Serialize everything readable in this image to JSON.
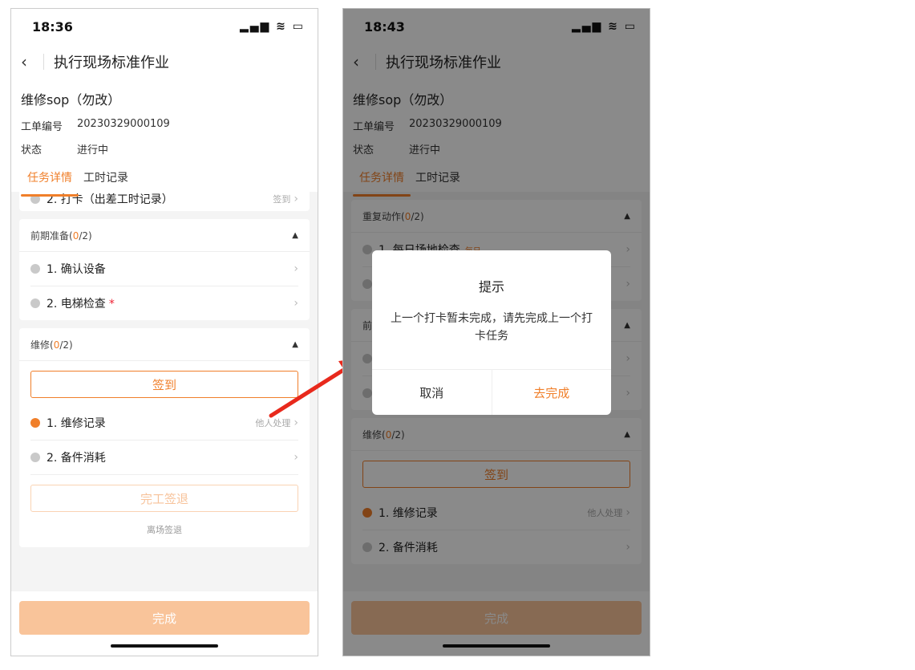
{
  "phone1": {
    "time": "18:36",
    "nav_title": "执行现场标准作业",
    "order_title": "维修sop（勿改）",
    "order_no_label": "工单编号",
    "order_no": "20230329000109",
    "status_label": "状态",
    "status": "进行中",
    "tab1": "任务详情",
    "tab2": "工时记录",
    "cut_row": "2. 打卡（出差工时记录）",
    "cut_tail": "签到",
    "sec1_title": "前期准备",
    "sec1_count_open": "(",
    "sec1_count": "0",
    "sec1_count_close": "/2)",
    "sec1_items": [
      "1. 确认设备",
      "2. 电梯检查"
    ],
    "sec1_star": "*",
    "sec2_title": "维修",
    "sec2_count_open": "(",
    "sec2_count": "0",
    "sec2_count_close": "/2)",
    "checkin": "签到",
    "sec2_items": [
      "1. 维修记录",
      "2. 备件消耗"
    ],
    "sec2_item1_tail": "他人处理",
    "finish_checkout": "完工签退",
    "leave_checkout": "离场签退",
    "complete": "完成"
  },
  "phone2": {
    "time": "18:43",
    "nav_title": "执行现场标准作业",
    "order_title": "维修sop（勿改）",
    "order_no_label": "工单编号",
    "order_no": "20230329000109",
    "status_label": "状态",
    "status": "进行中",
    "tab1": "任务详情",
    "tab2": "工时记录",
    "sec0_title": "重复动作",
    "sec0_count_open": "(",
    "sec0_count": "0",
    "sec0_count_close": "/2)",
    "sec0_item1": "1. 每日场地检查",
    "sec0_item1_tag": "每日",
    "sec1_title_partial": "前",
    "sec2_title": "维修",
    "sec2_count_open": "(",
    "sec2_count": "0",
    "sec2_count_close": "/2)",
    "checkin": "签到",
    "sec2_items": [
      "1. 维修记录",
      "2. 备件消耗"
    ],
    "sec2_item1_tail": "他人处理",
    "complete": "完成",
    "dialog": {
      "title": "提示",
      "message": "上一个打卡暂未完成，请先完成上一个打卡任务",
      "cancel": "取消",
      "confirm": "去完成"
    }
  },
  "status_icons": "signal-wifi-battery-icons",
  "colors": {
    "accent": "#f07f2a",
    "arrow": "#e8291c",
    "star": "#ee2233"
  }
}
